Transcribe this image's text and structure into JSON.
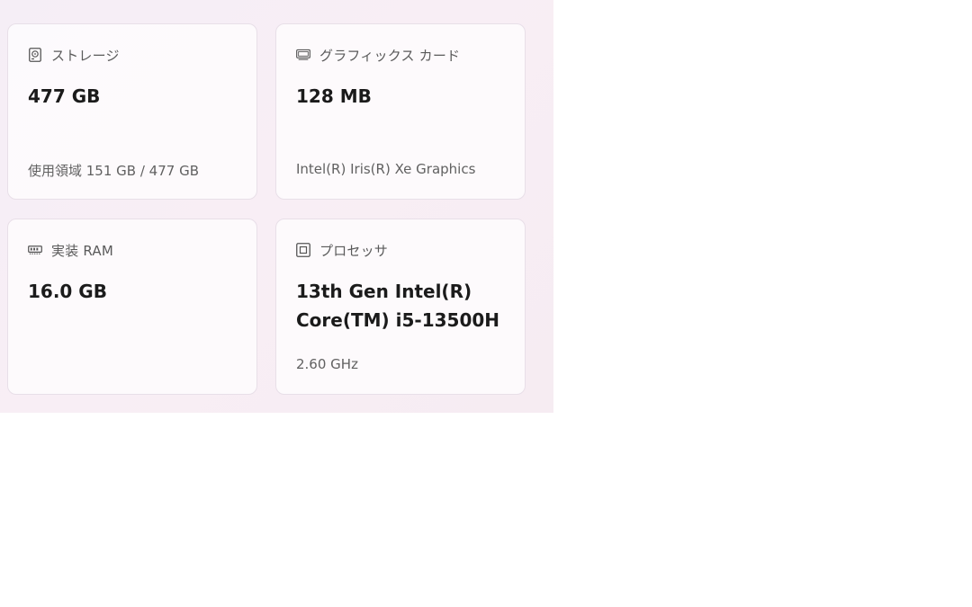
{
  "cards": {
    "storage": {
      "icon": "hard-drive-icon",
      "label": "ストレージ",
      "value": "477 GB",
      "sub": "使用領域 151 GB / 477 GB"
    },
    "gpu": {
      "icon": "graphics-card-icon",
      "label": "グラフィックス カード",
      "value": "128 MB",
      "sub": "Intel(R) Iris(R) Xe Graphics"
    },
    "ram": {
      "icon": "memory-icon",
      "label": "実装 RAM",
      "value": "16.0 GB"
    },
    "cpu": {
      "icon": "processor-icon",
      "label": "プロセッサ",
      "value": "13th Gen Intel(R) Core(TM) i5-13500H",
      "sub": "2.60 GHz"
    }
  },
  "colors": {
    "panel_bg": "#f6eef5",
    "card_bg": "#fbf8fb",
    "card_border": "#e8dfe8",
    "value_text": "#1b1b1b",
    "label_text": "#5a5a5a"
  }
}
